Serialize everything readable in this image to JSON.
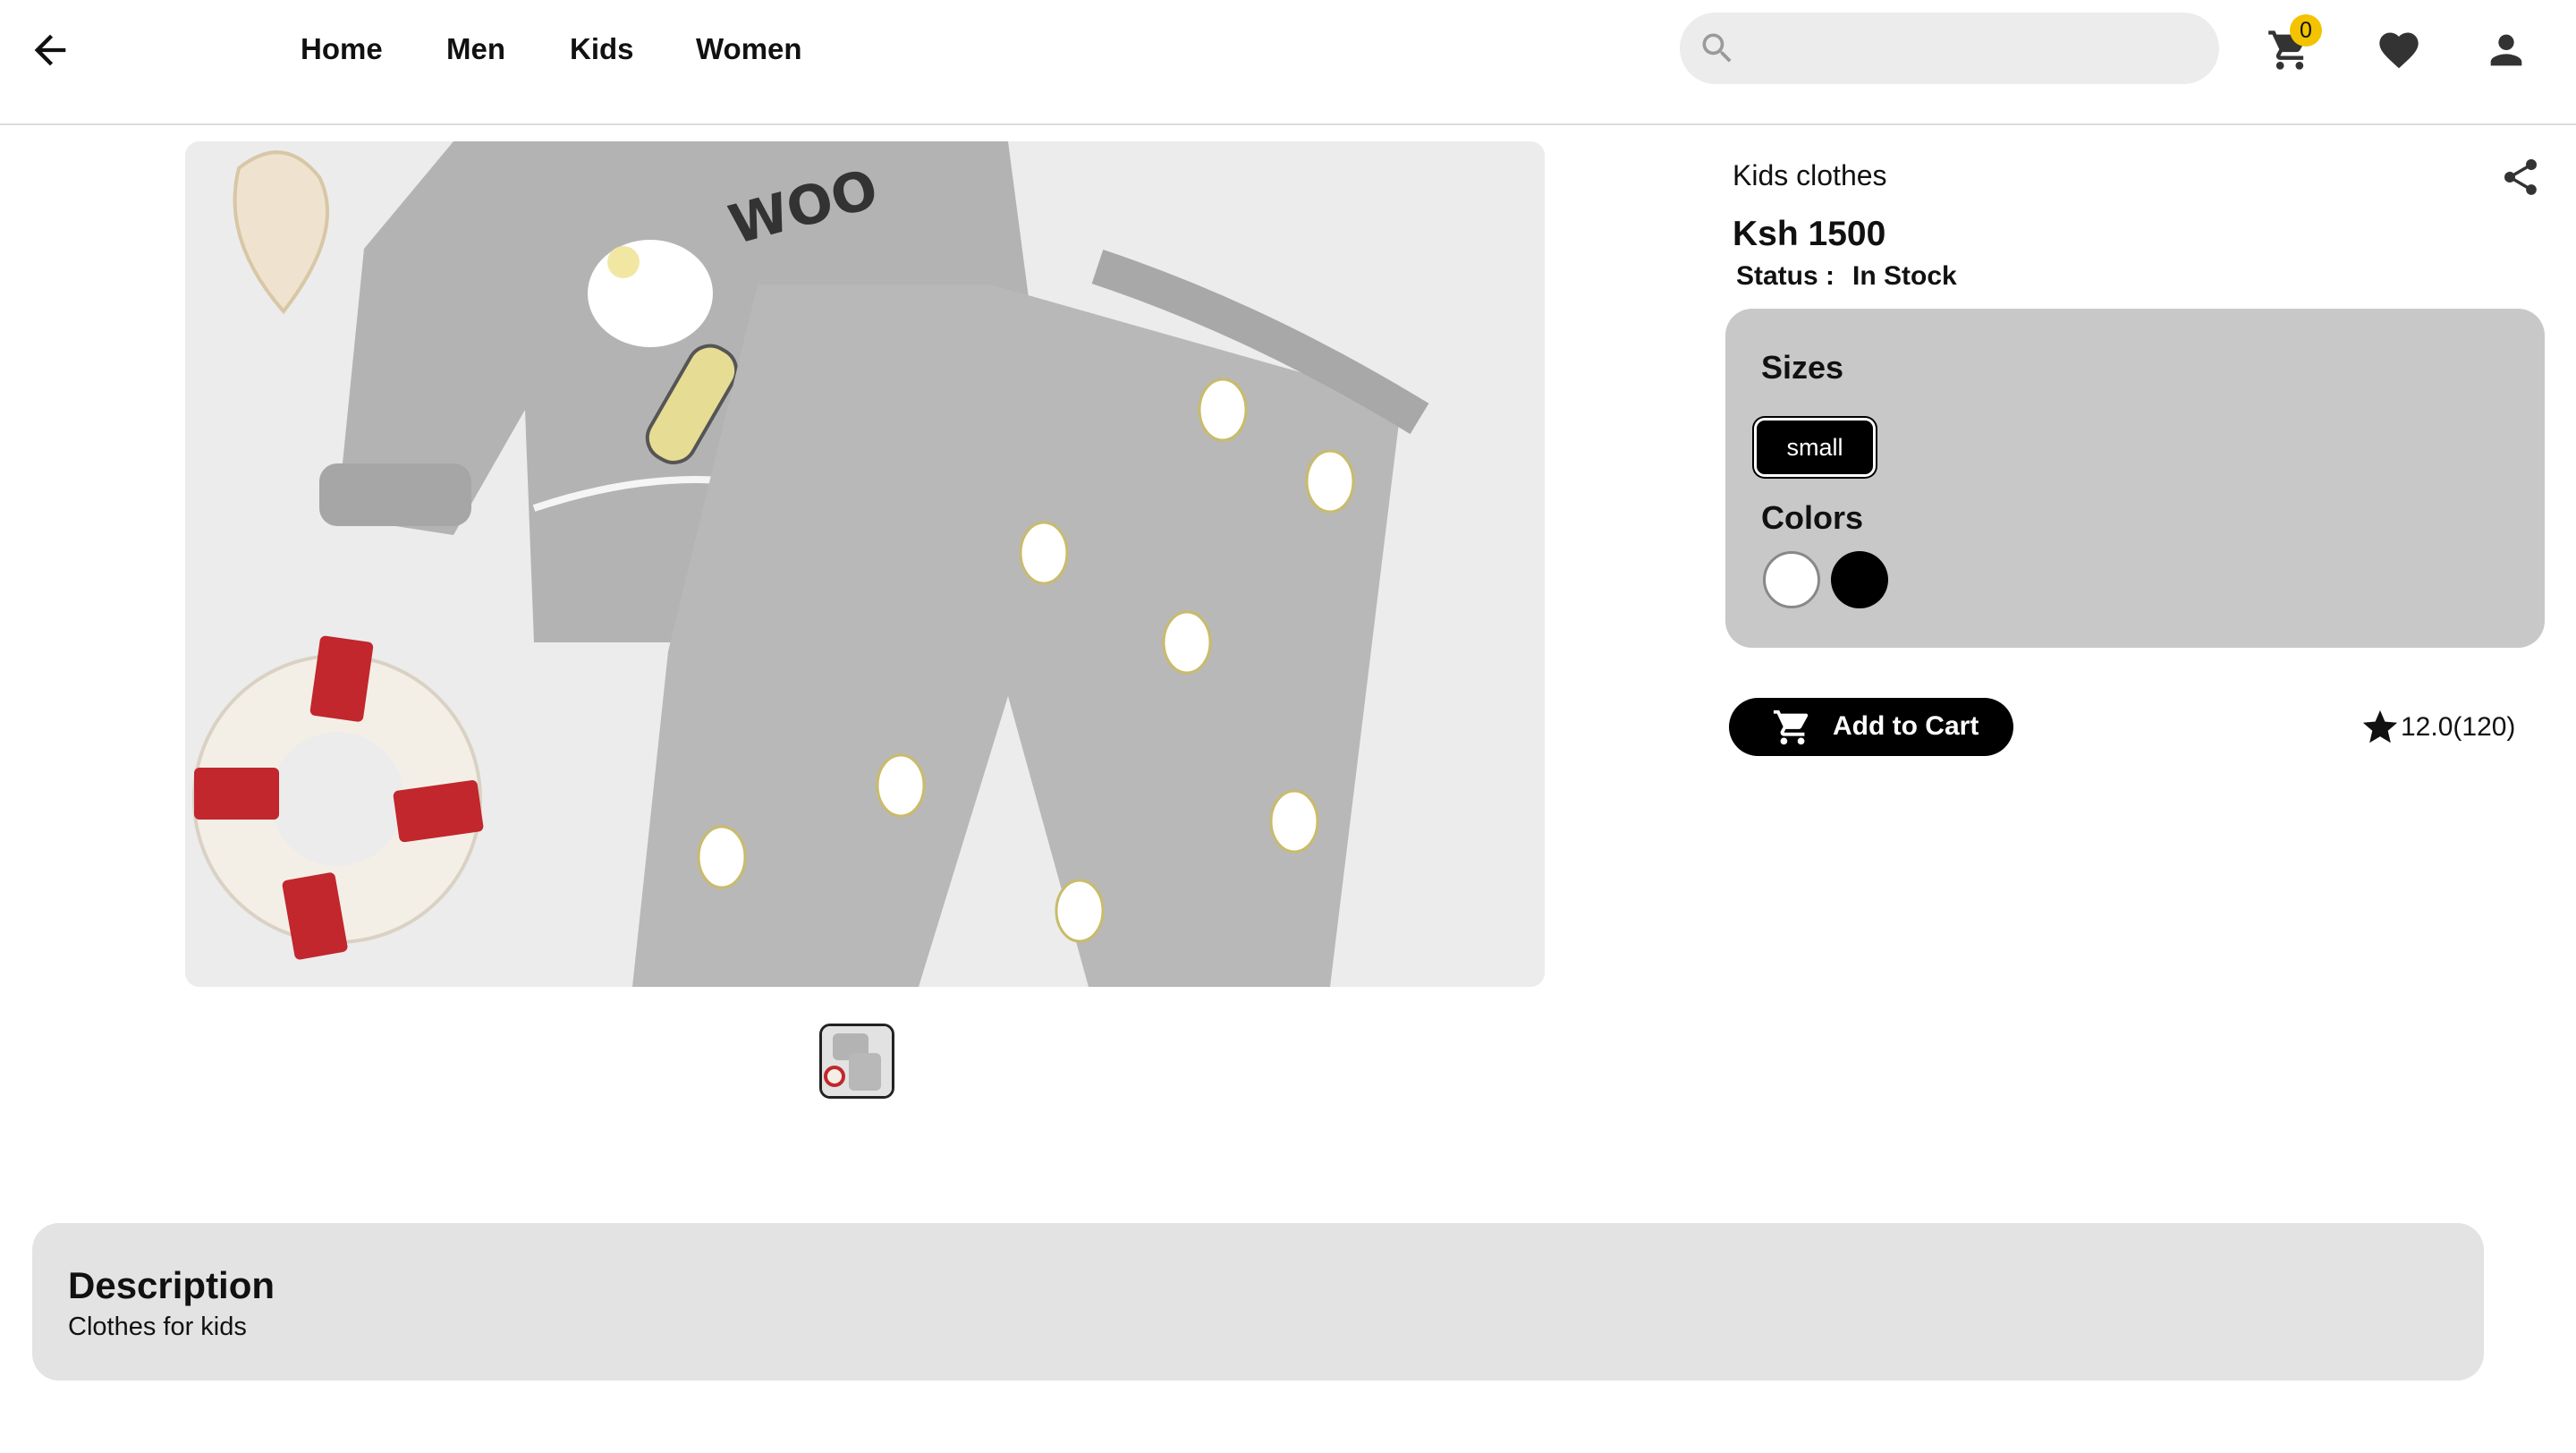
{
  "header": {
    "nav": [
      {
        "label": "Home"
      },
      {
        "label": "Men"
      },
      {
        "label": "Kids"
      },
      {
        "label": "Women"
      }
    ],
    "search": {
      "value": "",
      "placeholder": "",
      "icon": "search-icon"
    },
    "cart_count": "0",
    "icons": [
      "back-arrow-icon",
      "cart-icon",
      "heart-icon",
      "account-icon"
    ]
  },
  "product": {
    "name": "Kids clothes",
    "price": "Ksh 1500",
    "status_label": "Status :",
    "status_value": "In Stock",
    "sizes_heading": "Sizes",
    "sizes": [
      {
        "label": "small",
        "selected": true
      }
    ],
    "colors_heading": "Colors",
    "colors": [
      {
        "hex": "#ffffff",
        "selected": true
      },
      {
        "hex": "#000000",
        "selected": false
      }
    ],
    "add_to_cart_label": "Add to Cart",
    "rating": "12.0(120)",
    "thumbnails": 1
  },
  "description": {
    "heading": "Description",
    "text": "Clothes for kids"
  },
  "colors": {
    "badge": "#f3c300",
    "options_panel": "#c8c8c8",
    "description_panel": "#e3e3e3",
    "primary_button": "#000000"
  }
}
